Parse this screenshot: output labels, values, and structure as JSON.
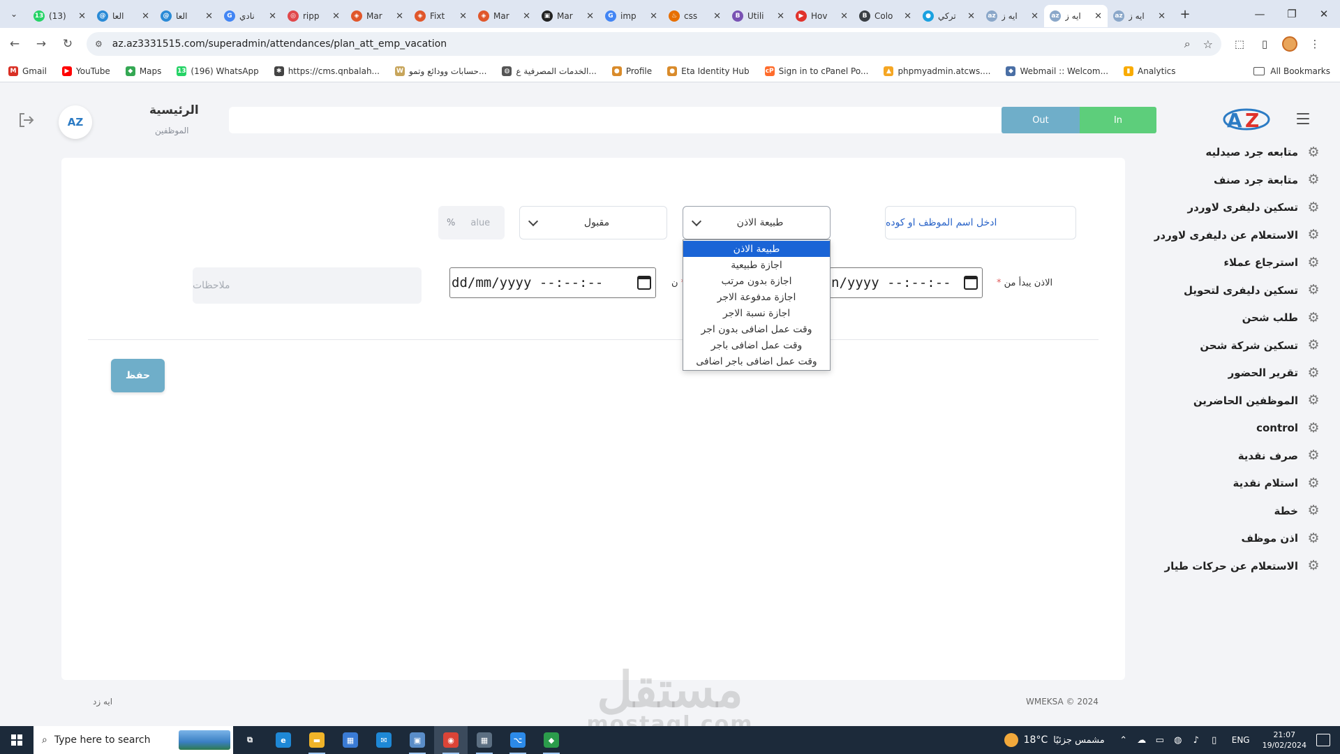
{
  "browser": {
    "tabs": [
      {
        "label": "(13)",
        "icon": "whatsapp-icon",
        "color": "#25d366",
        "glyph": "13"
      },
      {
        "label": "العا",
        "icon": "globe-icon",
        "color": "#2a8ad6",
        "glyph": "@"
      },
      {
        "label": "العا",
        "icon": "globe-icon",
        "color": "#2a8ad6",
        "glyph": "@"
      },
      {
        "label": "نادي",
        "icon": "google-icon",
        "color": "#4285f4",
        "glyph": "G"
      },
      {
        "label": "ripp",
        "icon": "ripple-icon",
        "color": "#e0484b",
        "glyph": "◎"
      },
      {
        "label": "Mar",
        "icon": "laravel-icon",
        "color": "#e0572b",
        "glyph": "◈"
      },
      {
        "label": "Fixt",
        "icon": "laravel-icon",
        "color": "#e0572b",
        "glyph": "◈"
      },
      {
        "label": "Mar",
        "icon": "laravel-icon",
        "color": "#e0572b",
        "glyph": "◈"
      },
      {
        "label": "Mar",
        "icon": "terminal-icon",
        "color": "#222222",
        "glyph": "▣"
      },
      {
        "label": "imp",
        "icon": "google-icon",
        "color": "#4285f4",
        "glyph": "G"
      },
      {
        "label": "css",
        "icon": "java-icon",
        "color": "#e76f00",
        "glyph": "♨"
      },
      {
        "label": "Utili",
        "icon": "bootstrap-icon",
        "color": "#7952b3",
        "glyph": "B"
      },
      {
        "label": "Hov",
        "icon": "video-icon",
        "color": "#e0322b",
        "glyph": "▶"
      },
      {
        "label": "Colo",
        "icon": "bootstrap-icon",
        "color": "#3a3f44",
        "glyph": "B"
      },
      {
        "label": "تركي",
        "icon": "circle-icon",
        "color": "#1aa1e0",
        "glyph": "●"
      },
      {
        "label": "ايه ز",
        "icon": "site-icon",
        "color": "#8aa7c9",
        "glyph": "az"
      },
      {
        "label": "ايه ز",
        "icon": "site-icon",
        "color": "#8aa7c9",
        "glyph": "az",
        "active": true
      },
      {
        "label": "ايه ز",
        "icon": "site-icon",
        "color": "#8aa7c9",
        "glyph": "az"
      }
    ],
    "url": "az.az3331515.com/superadmin/attendances/plan_att_emp_vacation",
    "bookmarks": [
      {
        "label": "Gmail",
        "icon": "gmail-icon",
        "color": "#d93025",
        "glyph": "M"
      },
      {
        "label": "YouTube",
        "icon": "youtube-icon",
        "color": "#ff0000",
        "glyph": "▶"
      },
      {
        "label": "Maps",
        "icon": "maps-icon",
        "color": "#34a853",
        "glyph": "◆"
      },
      {
        "label": "(196) WhatsApp",
        "icon": "whatsapp-icon",
        "color": "#25d366",
        "glyph": "13"
      },
      {
        "label": "https://cms.qnbalah...",
        "icon": "gear-icon",
        "color": "#444444",
        "glyph": "✱"
      },
      {
        "label": "حسابات وودائع وتمو...",
        "icon": "bank-icon",
        "color": "#c7a55b",
        "glyph": "W"
      },
      {
        "label": "الخدمات المصرفية ع...",
        "icon": "globe-icon",
        "color": "#555555",
        "glyph": "◍"
      },
      {
        "label": "Profile",
        "icon": "burger-icon",
        "color": "#d98b2b",
        "glyph": "●"
      },
      {
        "label": "Eta Identity Hub",
        "icon": "eta-icon",
        "color": "#d98b2b",
        "glyph": "●"
      },
      {
        "label": "Sign in to cPanel Po...",
        "icon": "cpanel-icon",
        "color": "#ff6c2c",
        "glyph": "cP"
      },
      {
        "label": "phpmyadmin.atcws....",
        "icon": "phpmyadmin-icon",
        "color": "#f5a623",
        "glyph": "▲"
      },
      {
        "label": "Webmail :: Welcom...",
        "icon": "webmail-icon",
        "color": "#4a6fa5",
        "glyph": "◆"
      },
      {
        "label": "Analytics",
        "icon": "analytics-icon",
        "color": "#f9ab00",
        "glyph": "▮"
      }
    ],
    "all_bookmarks": "All Bookmarks"
  },
  "topbar": {
    "page_title": "الرئيسية",
    "page_subtitle": "الموظفين",
    "avatar_text": "AZ",
    "btn_out": "Out",
    "btn_in": "In"
  },
  "sidebar": {
    "items": [
      "متابعه جرد صيدليه",
      "متابعة جرد صنف",
      "تسكين دليفرى لاوردر",
      "الاستعلام عن دليفرى لاوردر",
      "استرجاع عملاء",
      "تسكين دليفرى لتحويل",
      "طلب شحن",
      "تسكين شركة شحن",
      "تقرير الحضور",
      "الموظفين الحاضرين",
      "control",
      "صرف نقدية",
      "استلام نقدية",
      "خطة",
      "اذن موظف",
      "الاستعلام عن حركات طيار"
    ]
  },
  "form": {
    "employee_placeholder": "ادخل اسم الموظف او كوده",
    "leave_type_value": "طبيعة الاذن",
    "status_value": "مقبول",
    "percent_symbol": "%",
    "percent_placeholder": "alue",
    "start_label": "الاذن يبدأ من",
    "end_label": "ن",
    "required_mark": "*",
    "date_start_value": "n/yyyy --:--:--",
    "date_end_value": "dd/mm/yyyy --:--:--",
    "notes_placeholder": "ملاحظات",
    "save_label": "حفظ",
    "leave_type_options": [
      "طبيعة الاذن",
      "اجازة طبيعية",
      "اجازة بدون مرتب",
      "اجازة مدفوعة الاجر",
      "اجازة نسبة الاجر",
      "وقت عمل اضافى بدون اجر",
      "وقت عمل اضافى باجر",
      "وقت عمل اضافى باجر اضافى"
    ]
  },
  "footer": {
    "copyright": "WMEKSA © 2024",
    "user": "ايه زد"
  },
  "watermark": {
    "arabic": "مستقل",
    "latin": "mostaql.com"
  },
  "taskbar": {
    "search_placeholder": "Type here to search",
    "apps": [
      {
        "name": "task-view",
        "glyph": "⧉",
        "color": "#1c2a3a"
      },
      {
        "name": "edge",
        "glyph": "e",
        "color": "#1e88d6"
      },
      {
        "name": "file-explorer",
        "glyph": "▬",
        "color": "#f0b429"
      },
      {
        "name": "store",
        "glyph": "▦",
        "color": "#3a7bd5"
      },
      {
        "name": "mail",
        "glyph": "✉",
        "color": "#1e88d6"
      },
      {
        "name": "remote-desktop",
        "glyph": "▣",
        "color": "#5a8dc8"
      },
      {
        "name": "chrome",
        "glyph": "◉",
        "color": "#db4437"
      },
      {
        "name": "calculator",
        "glyph": "▦",
        "color": "#5c6f82"
      },
      {
        "name": "vscode",
        "glyph": "⌥",
        "color": "#2c8ae8"
      },
      {
        "name": "git",
        "glyph": "◆",
        "color": "#2b9c4b"
      }
    ],
    "weather_temp": "18°C",
    "weather_text": "مشمس جزئيًا",
    "language": "ENG",
    "time": "21:07",
    "date": "19/02/2024"
  },
  "colors": {
    "accent_blue": "#6faec9",
    "in_green": "#5dce7b",
    "selected_option": "#1a64d6"
  }
}
